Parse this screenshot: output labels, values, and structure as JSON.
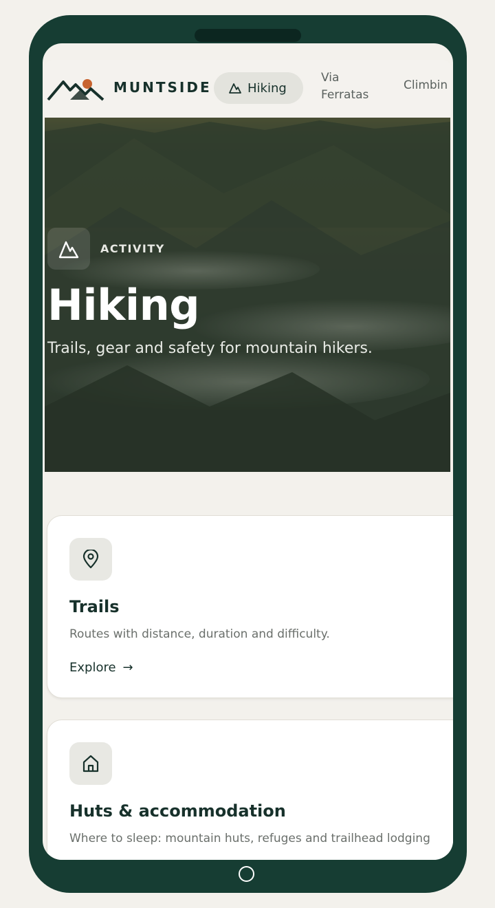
{
  "brand": {
    "name": "MUNTSIDE"
  },
  "nav": {
    "items": [
      {
        "label": "Hiking",
        "icon": "mountain-icon",
        "active": true
      },
      {
        "label": "Via\nFerratas"
      },
      {
        "label": "Climbin"
      }
    ]
  },
  "hero": {
    "eyebrow": "ACTIVITY",
    "title": "Hiking",
    "subtitle": "Trails, gear and safety for mountain hikers.",
    "icon": "mountain-icon"
  },
  "cards": [
    {
      "title": "Trails",
      "description": "Routes with distance, duration and difficulty.",
      "link": "Explore",
      "link_arrow": "→",
      "icon": "location-pin-icon"
    },
    {
      "title": "Huts & accommodation",
      "description": "Where to sleep: mountain huts, refuges and trailhead lodging",
      "icon": "house-icon"
    }
  ],
  "colors": {
    "frame": "#163d33",
    "brand_text": "#17312b",
    "background": "#f3f1ec",
    "accent_sun": "#c7632f"
  }
}
